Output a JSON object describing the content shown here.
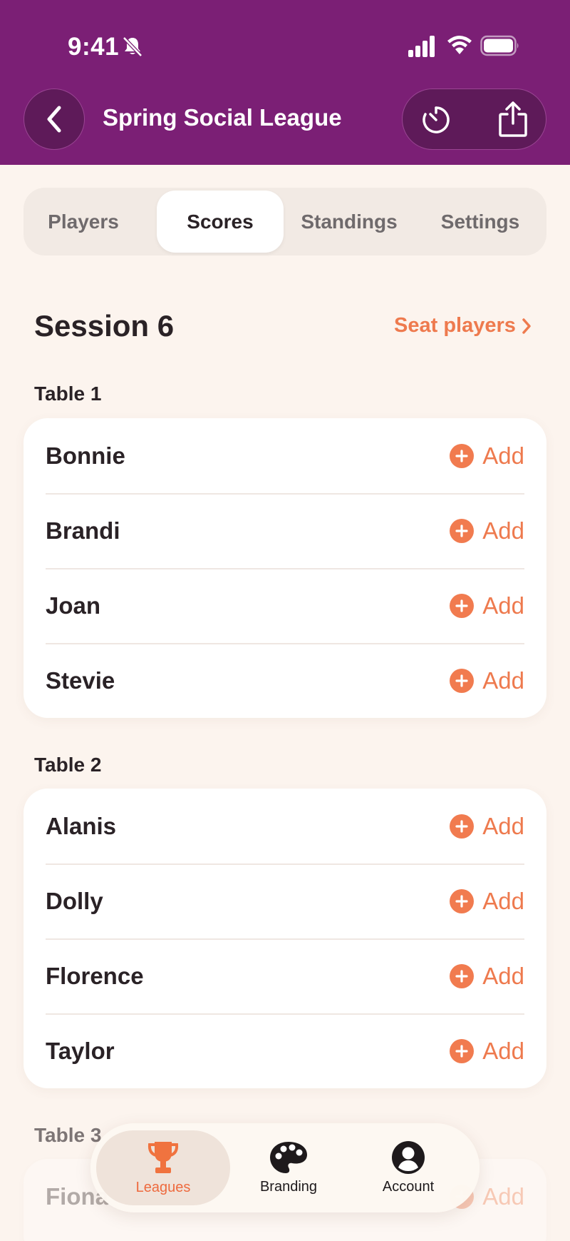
{
  "status_bar": {
    "time": "9:41"
  },
  "nav": {
    "title": "Spring Social League"
  },
  "segments": [
    "Players",
    "Scores",
    "Standings",
    "Settings"
  ],
  "session": {
    "title": "Session 6",
    "seat_link": "Seat players"
  },
  "tables": [
    {
      "label": "Table 1",
      "players": [
        "Bonnie",
        "Brandi",
        "Joan",
        "Stevie"
      ]
    },
    {
      "label": "Table 2",
      "players": [
        "Alanis",
        "Dolly",
        "Florence",
        "Taylor"
      ]
    },
    {
      "label": "Table 3",
      "players": [
        "Fiona"
      ]
    }
  ],
  "add_label": "Add",
  "tabbar": {
    "items": [
      "Leagues",
      "Branding",
      "Account"
    ],
    "active": "Leagues"
  },
  "colors": {
    "header": "#7B1F75",
    "accent": "#F17B4F",
    "background": "#FCF4EE"
  },
  "icons": {
    "back": "chevron-left-icon",
    "timer": "timer-icon",
    "share": "share-icon",
    "add": "plus-circle-icon",
    "leagues": "trophy-icon",
    "branding": "palette-icon",
    "account": "person-circle-icon"
  }
}
